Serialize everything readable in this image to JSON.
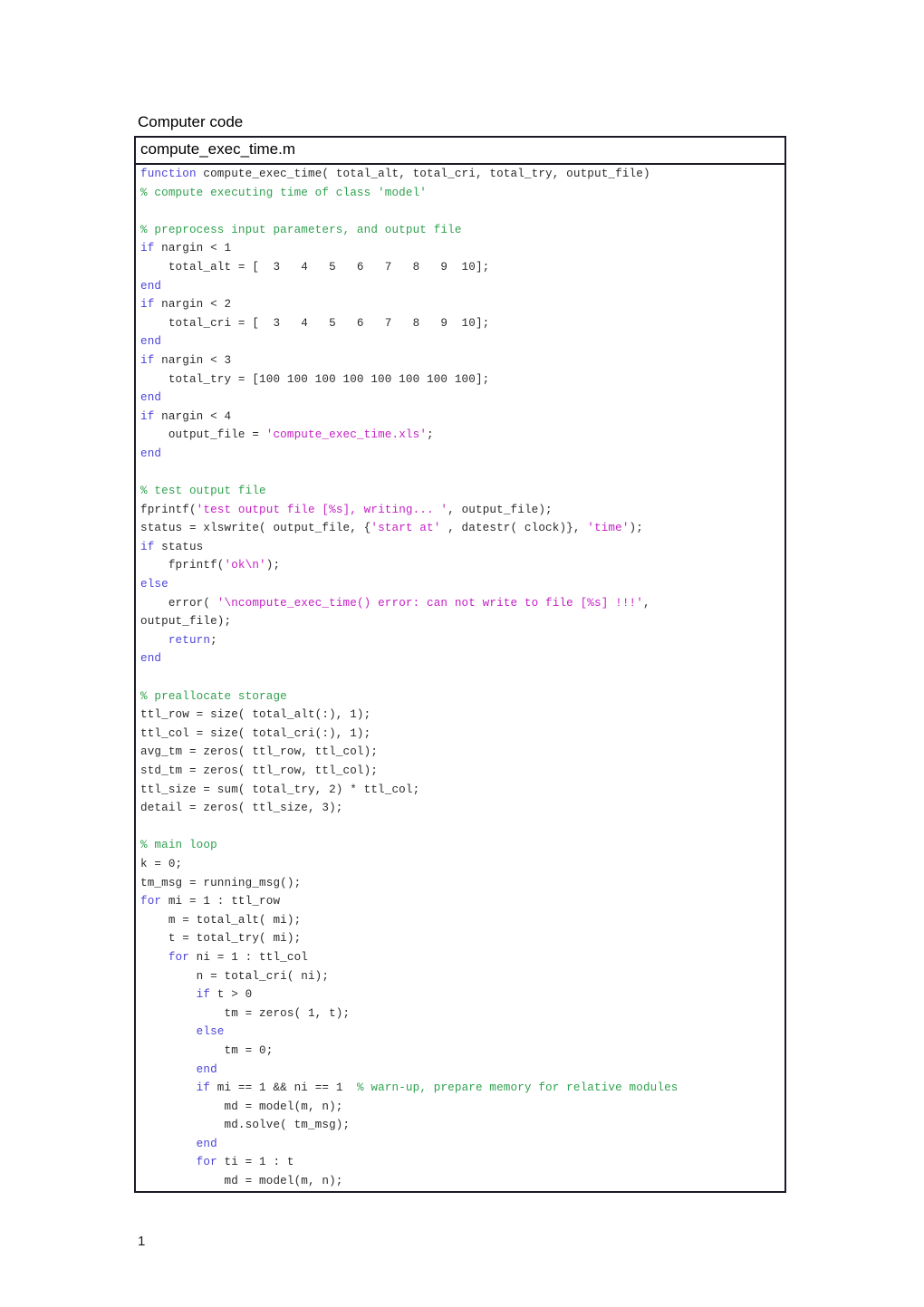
{
  "document": {
    "caption": "Computer code",
    "filename": "compute_exec_time.m",
    "page_number": "1"
  },
  "colors": {
    "keyword": "#4b44d8",
    "comment": "#2fa14e",
    "string": "#c41fc4",
    "plain": "#2a2a2a",
    "border": "#1b1b28",
    "background": "#ffffff"
  },
  "code": {
    "language": "matlab",
    "lines": [
      [
        {
          "t": "function",
          "c": "kw"
        },
        {
          "t": " compute_exec_time( total_alt, total_cri, total_try, output_file)",
          "c": "plain"
        }
      ],
      [
        {
          "t": "% compute executing time of class 'model'",
          "c": "cmt"
        }
      ],
      [
        {
          "t": "",
          "c": "plain"
        }
      ],
      [
        {
          "t": "% preprocess input parameters, and output file",
          "c": "cmt"
        }
      ],
      [
        {
          "t": "if",
          "c": "kw"
        },
        {
          "t": " nargin < 1",
          "c": "plain"
        }
      ],
      [
        {
          "t": "    total_alt = [  3   4   5   6   7   8   9  10];",
          "c": "plain"
        }
      ],
      [
        {
          "t": "end",
          "c": "kw"
        }
      ],
      [
        {
          "t": "if",
          "c": "kw"
        },
        {
          "t": " nargin < 2",
          "c": "plain"
        }
      ],
      [
        {
          "t": "    total_cri = [  3   4   5   6   7   8   9  10];",
          "c": "plain"
        }
      ],
      [
        {
          "t": "end",
          "c": "kw"
        }
      ],
      [
        {
          "t": "if",
          "c": "kw"
        },
        {
          "t": " nargin < 3",
          "c": "plain"
        }
      ],
      [
        {
          "t": "    total_try = [100 100 100 100 100 100 100 100];",
          "c": "plain"
        }
      ],
      [
        {
          "t": "end",
          "c": "kw"
        }
      ],
      [
        {
          "t": "if",
          "c": "kw"
        },
        {
          "t": " nargin < 4",
          "c": "plain"
        }
      ],
      [
        {
          "t": "    output_file = ",
          "c": "plain"
        },
        {
          "t": "'compute_exec_time.xls'",
          "c": "str"
        },
        {
          "t": ";",
          "c": "plain"
        }
      ],
      [
        {
          "t": "end",
          "c": "kw"
        }
      ],
      [
        {
          "t": "",
          "c": "plain"
        }
      ],
      [
        {
          "t": "% test output file",
          "c": "cmt"
        }
      ],
      [
        {
          "t": "fprintf(",
          "c": "plain"
        },
        {
          "t": "'test output file [%s], writing... '",
          "c": "str"
        },
        {
          "t": ", output_file);",
          "c": "plain"
        }
      ],
      [
        {
          "t": "status = xlswrite( output_file, {",
          "c": "plain"
        },
        {
          "t": "'start at'",
          "c": "str"
        },
        {
          "t": " , datestr( clock)}, ",
          "c": "plain"
        },
        {
          "t": "'time'",
          "c": "str"
        },
        {
          "t": ");",
          "c": "plain"
        }
      ],
      [
        {
          "t": "if",
          "c": "kw"
        },
        {
          "t": " status",
          "c": "plain"
        }
      ],
      [
        {
          "t": "    fprintf(",
          "c": "plain"
        },
        {
          "t": "'ok\\n'",
          "c": "str"
        },
        {
          "t": ");",
          "c": "plain"
        }
      ],
      [
        {
          "t": "else",
          "c": "kw"
        }
      ],
      [
        {
          "t": "    error( ",
          "c": "plain"
        },
        {
          "t": "'\\ncompute_exec_time() error: can not write to file [%s] !!!'",
          "c": "str"
        },
        {
          "t": ",",
          "c": "plain"
        }
      ],
      [
        {
          "t": "output_file);",
          "c": "plain"
        }
      ],
      [
        {
          "t": "    ",
          "c": "plain"
        },
        {
          "t": "return",
          "c": "kw"
        },
        {
          "t": ";",
          "c": "plain"
        }
      ],
      [
        {
          "t": "end",
          "c": "kw"
        }
      ],
      [
        {
          "t": "",
          "c": "plain"
        }
      ],
      [
        {
          "t": "% preallocate storage",
          "c": "cmt"
        }
      ],
      [
        {
          "t": "ttl_row = size( total_alt(:), 1);",
          "c": "plain"
        }
      ],
      [
        {
          "t": "ttl_col = size( total_cri(:), 1);",
          "c": "plain"
        }
      ],
      [
        {
          "t": "avg_tm = zeros( ttl_row, ttl_col);",
          "c": "plain"
        }
      ],
      [
        {
          "t": "std_tm = zeros( ttl_row, ttl_col);",
          "c": "plain"
        }
      ],
      [
        {
          "t": "ttl_size = sum( total_try, 2) * ttl_col;",
          "c": "plain"
        }
      ],
      [
        {
          "t": "detail = zeros( ttl_size, 3);",
          "c": "plain"
        }
      ],
      [
        {
          "t": "",
          "c": "plain"
        }
      ],
      [
        {
          "t": "% main loop",
          "c": "cmt"
        }
      ],
      [
        {
          "t": "k = 0;",
          "c": "plain"
        }
      ],
      [
        {
          "t": "tm_msg = running_msg();",
          "c": "plain"
        }
      ],
      [
        {
          "t": "for",
          "c": "kw"
        },
        {
          "t": " mi = 1 : ttl_row",
          "c": "plain"
        }
      ],
      [
        {
          "t": "    m = total_alt( mi);",
          "c": "plain"
        }
      ],
      [
        {
          "t": "    t = total_try( mi);",
          "c": "plain"
        }
      ],
      [
        {
          "t": "    ",
          "c": "plain"
        },
        {
          "t": "for",
          "c": "kw"
        },
        {
          "t": " ni = 1 : ttl_col",
          "c": "plain"
        }
      ],
      [
        {
          "t": "        n = total_cri( ni);",
          "c": "plain"
        }
      ],
      [
        {
          "t": "        ",
          "c": "plain"
        },
        {
          "t": "if",
          "c": "kw"
        },
        {
          "t": " t > 0",
          "c": "plain"
        }
      ],
      [
        {
          "t": "            tm = zeros( 1, t);",
          "c": "plain"
        }
      ],
      [
        {
          "t": "        ",
          "c": "plain"
        },
        {
          "t": "else",
          "c": "kw"
        }
      ],
      [
        {
          "t": "            tm = 0;",
          "c": "plain"
        }
      ],
      [
        {
          "t": "        ",
          "c": "plain"
        },
        {
          "t": "end",
          "c": "kw"
        }
      ],
      [
        {
          "t": "        ",
          "c": "plain"
        },
        {
          "t": "if",
          "c": "kw"
        },
        {
          "t": " mi == 1 && ni == 1  ",
          "c": "plain"
        },
        {
          "t": "% warn-up, prepare memory for relative modules",
          "c": "cmt"
        }
      ],
      [
        {
          "t": "            md = model(m, n);",
          "c": "plain"
        }
      ],
      [
        {
          "t": "            md.solve( tm_msg);",
          "c": "plain"
        }
      ],
      [
        {
          "t": "        ",
          "c": "plain"
        },
        {
          "t": "end",
          "c": "kw"
        }
      ],
      [
        {
          "t": "        ",
          "c": "plain"
        },
        {
          "t": "for",
          "c": "kw"
        },
        {
          "t": " ti = 1 : t",
          "c": "plain"
        }
      ],
      [
        {
          "t": "            md = model(m, n);",
          "c": "plain"
        }
      ]
    ]
  }
}
